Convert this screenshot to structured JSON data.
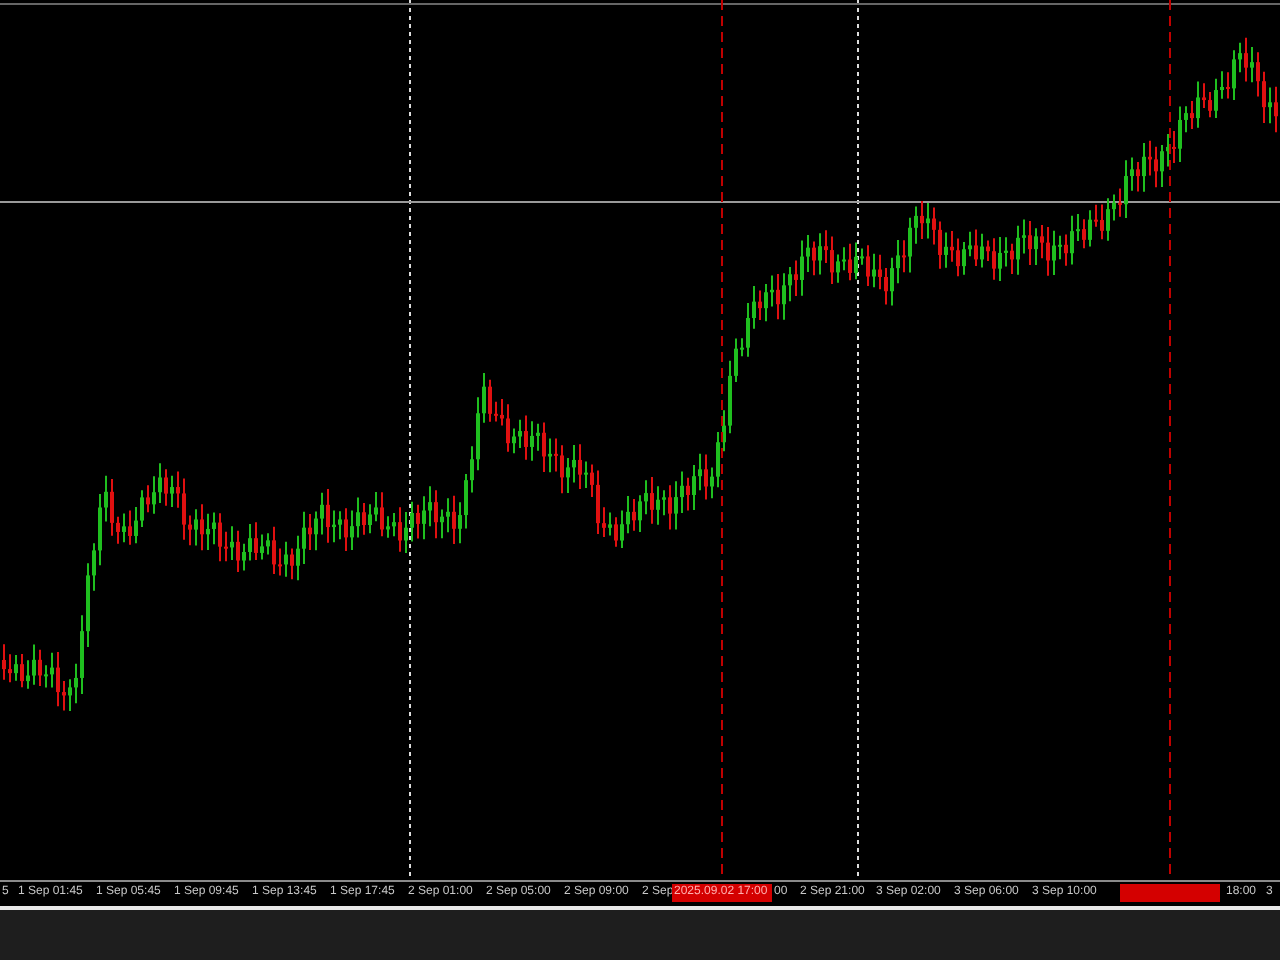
{
  "chart": {
    "time_axis": {
      "labels": [
        "5",
        "1 Sep 01:45",
        "1 Sep 05:45",
        "1 Sep 09:45",
        "1 Sep 13:45",
        "1 Sep 17:45",
        "2 Sep 01:00",
        "2 Sep 05:00",
        "2 Sep 09:00",
        "2 Sep",
        "00",
        "2 Sep 21:00",
        "3 Sep 02:00",
        "3 Sep 06:00",
        "3 Sep 10:00",
        "18:00",
        "3"
      ]
    },
    "markers": [
      {
        "kind": "labeled",
        "label": "2025.09.02 17:00"
      },
      {
        "kind": "blank"
      }
    ]
  }
}
